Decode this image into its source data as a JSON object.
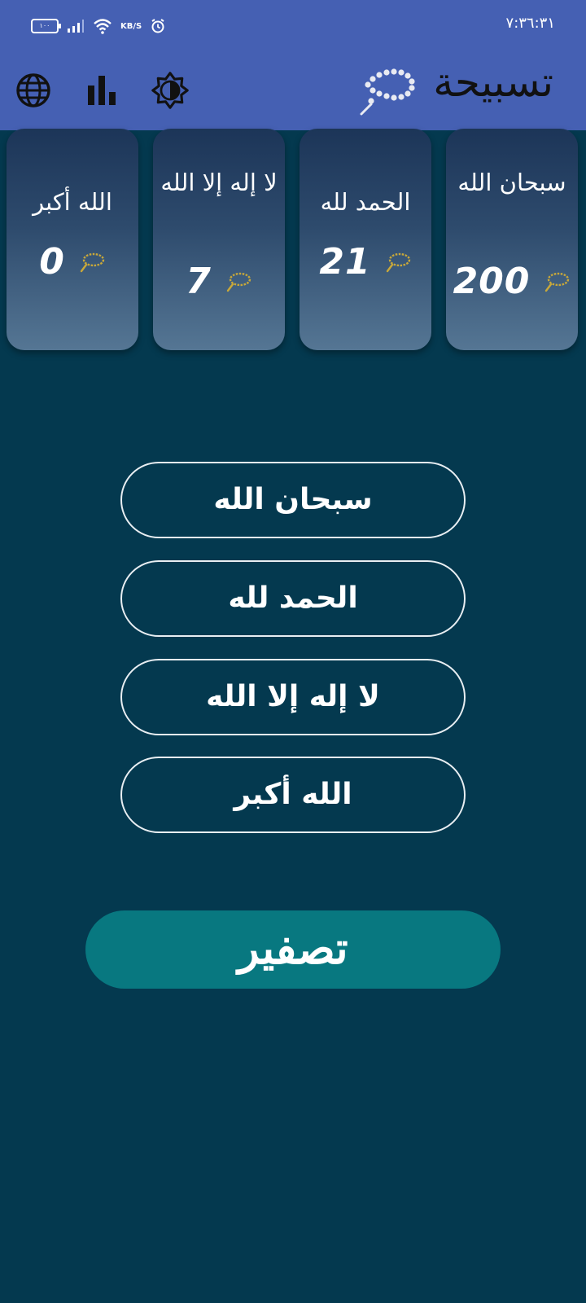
{
  "status_bar": {
    "time": "٧:٣٦:٣١",
    "battery": "١٠٠",
    "speed_unit": "KB/S",
    "icons": [
      "battery-icon",
      "signal-icon",
      "wifi-icon",
      "alarm-icon"
    ]
  },
  "app_bar": {
    "title": "تسبيحة",
    "icons": [
      "language-globe-icon",
      "statistics-bar-chart-icon",
      "brightness-theme-icon",
      "prayer-beads-icon"
    ],
    "color": "#4560b3"
  },
  "cards": [
    {
      "label": "سبحان الله",
      "count": "200"
    },
    {
      "label": "الحمد لله",
      "count": "21"
    },
    {
      "label": "لا إله إلا الله",
      "count": "7"
    },
    {
      "label": "الله أكبر",
      "count": "0"
    }
  ],
  "buttons": [
    {
      "label": "سبحان الله"
    },
    {
      "label": "الحمد لله"
    },
    {
      "label": "لا إله إلا الله"
    },
    {
      "label": "الله أكبر"
    }
  ],
  "reset": {
    "label": "تصفير",
    "color": "#087880"
  },
  "colors": {
    "background": "#04394f",
    "beads_accent": "#c8a83a"
  }
}
